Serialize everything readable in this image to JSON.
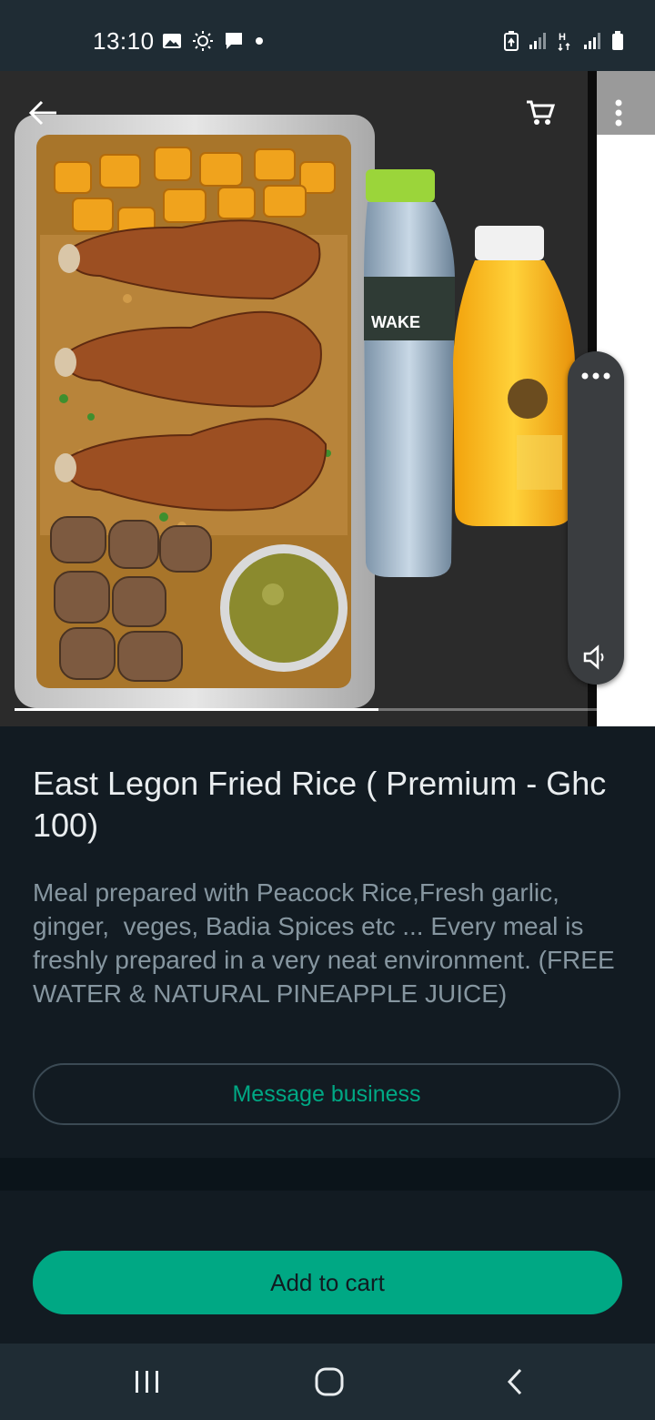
{
  "status_bar": {
    "time": "13:10",
    "left_icons": [
      "gallery-icon",
      "brightness-icon",
      "chat-icon",
      "dot-icon"
    ],
    "right_icons": [
      "battery-saver-icon",
      "signal-icon",
      "data-h-icon",
      "signal-icon",
      "battery-icon"
    ]
  },
  "photo": {
    "alt": "Fried rice with chicken, water bottle and pineapple juice",
    "carousel_progress": 0.58
  },
  "product": {
    "title": "East Legon Fried Rice ( Premium - Ghc 100)",
    "description": "Meal prepared with Peacock Rice,Fresh garlic, ginger,  veges, Badia Spices etc ... Every meal is freshly prepared in a very neat environment. (FREE WATER & NATURAL PINEAPPLE JUICE)"
  },
  "actions": {
    "message_business": "Message business",
    "add_to_cart": "Add to cart"
  },
  "colors": {
    "accent": "#00a884",
    "background": "#121b22",
    "bar": "#1f2c34"
  }
}
